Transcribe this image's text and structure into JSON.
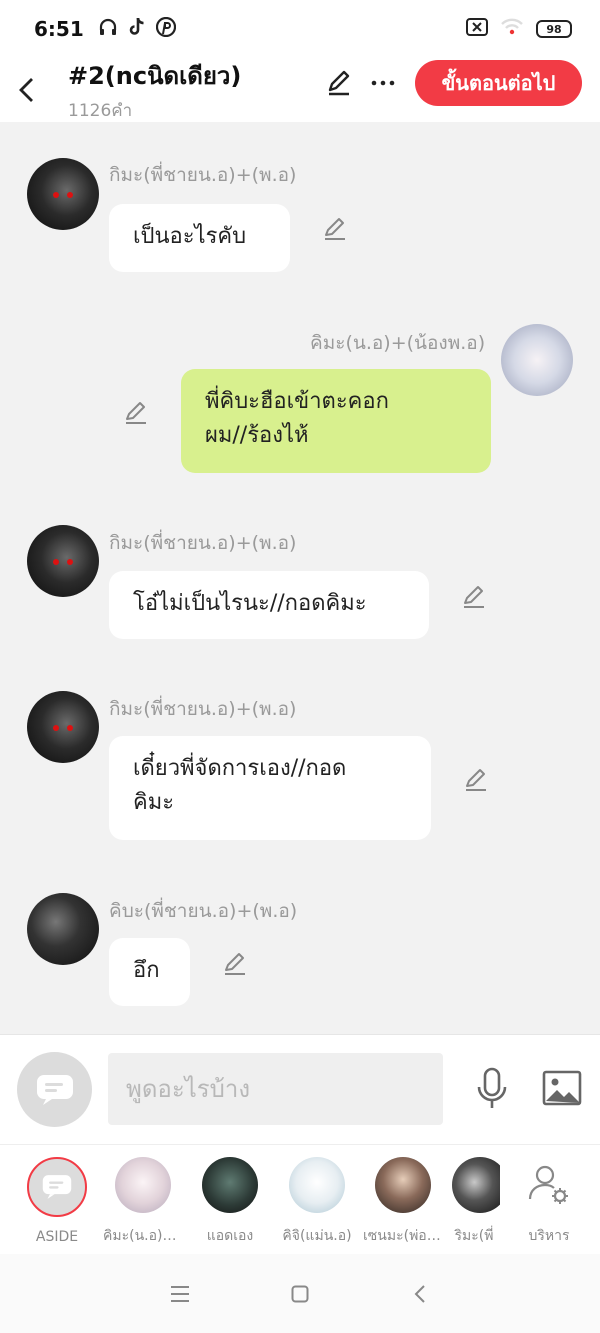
{
  "status_bar": {
    "time": "6:51",
    "battery": "98"
  },
  "header": {
    "title": "#2(ncนิดเดียว)",
    "word_count": "1126คำ",
    "next_button": "ขั้นตอนต่อไป"
  },
  "messages": [
    {
      "sender": "กิมะ(พี่ชายน.อ)+(พ.อ)",
      "text": "เป็นอะไรคับ",
      "side": "left"
    },
    {
      "sender": "คิมะ(น.อ)+(น้องพ.อ)",
      "text": "พี่คิบะฮือเข้าตะคอกผม//ร้องไห้",
      "line1": "พี่คิบะฮือเข้าตะคอก",
      "line2": "ผม//ร้องไห้",
      "side": "right"
    },
    {
      "sender": "กิมะ(พี่ชายน.อ)+(พ.อ)",
      "text": "โอ๋ไม่เป็นไรนะ//กอดคิมะ",
      "side": "left"
    },
    {
      "sender": "กิมะ(พี่ชายน.อ)+(พ.อ)",
      "text": "เดี๋ยวพี่จัดการเอง//กอดคิมะ",
      "line1": "เดี๋ยวพี่จัดการเอง//กอด",
      "line2": "คิมะ",
      "side": "left"
    },
    {
      "sender": "คิบะ(พี่ชายน.อ)+(พ.อ)",
      "text": "อึก",
      "side": "left"
    }
  ],
  "input": {
    "placeholder": "พูดอะไรบ้าง"
  },
  "characters": [
    {
      "label": "ASIDE"
    },
    {
      "label": "คิมะ(น.อ)+(น้องพ.อ)"
    },
    {
      "label": "แอดเอง"
    },
    {
      "label": "คิจิ(แม่น.อ)"
    },
    {
      "label": "เซนมะ(พ่อน.อ)"
    },
    {
      "label": "ริมะ(พี่"
    },
    {
      "label": "บริหาร"
    }
  ],
  "colors": {
    "accent": "#f23b45",
    "my_bubble": "#d8f08e",
    "background": "#f2f2f2"
  }
}
